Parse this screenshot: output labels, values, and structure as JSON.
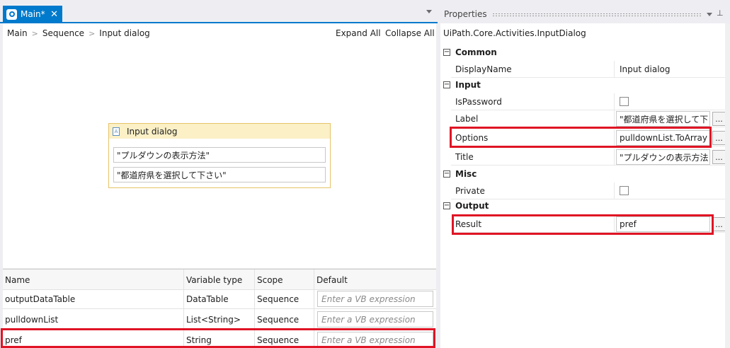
{
  "tab": {
    "label": "Main*",
    "close": "✕"
  },
  "breadcrumb": [
    "Main",
    "Sequence",
    "Input dialog"
  ],
  "toolbar": {
    "expand_all": "Expand All",
    "collapse_all": "Collapse All"
  },
  "activity": {
    "title": "Input dialog",
    "icon_text": "A",
    "title_value": "\"プルダウンの表示方法\"",
    "label_value": "\"都道府県を選択して下さい\""
  },
  "variables": {
    "headers": [
      "Name",
      "Variable type",
      "Scope",
      "Default"
    ],
    "rows": [
      {
        "name": "outputDataTable",
        "type": "DataTable",
        "scope": "Sequence",
        "default": "Enter a VB expression"
      },
      {
        "name": "pulldownList",
        "type": "List<String>",
        "scope": "Sequence",
        "default": "Enter a VB expression"
      },
      {
        "name": "pref",
        "type": "String",
        "scope": "Sequence",
        "default": "Enter a VB expression"
      }
    ]
  },
  "properties": {
    "title": "Properties",
    "pin": "⊥",
    "type_name": "UiPath.Core.Activities.InputDialog",
    "collapse_symbol": "−",
    "categories": {
      "common": "Common",
      "input": "Input",
      "misc": "Misc",
      "output": "Output"
    },
    "rows": {
      "display_name": {
        "name": "DisplayName",
        "value": "Input dialog"
      },
      "is_password": {
        "name": "IsPassword",
        "checked": false
      },
      "label": {
        "name": "Label",
        "value": "\"都道府県を選択して下"
      },
      "options": {
        "name": "Options",
        "value": "pulldownList.ToArray"
      },
      "title": {
        "name": "Title",
        "value": "\"プルダウンの表示方法"
      },
      "private": {
        "name": "Private",
        "checked": false
      },
      "result": {
        "name": "Result",
        "value": "pref"
      }
    },
    "ellipsis": "..."
  },
  "colors": {
    "accent": "#007acc",
    "highlight": "#e01424",
    "activity_border": "#e6c367"
  }
}
